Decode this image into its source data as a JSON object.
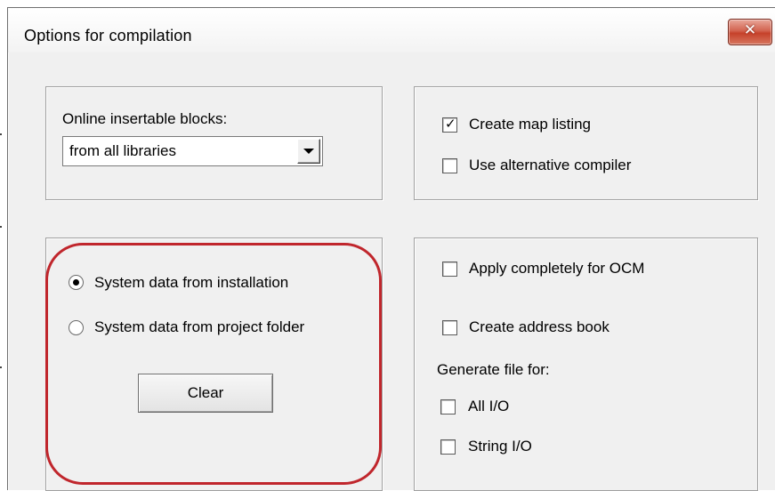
{
  "window": {
    "title": "Options for compilation",
    "close_glyph": "✕"
  },
  "blocks_group": {
    "label": "Online insertable blocks:",
    "select_value": "from all libraries"
  },
  "options_group": {
    "create_map_listing": {
      "label": "Create map listing",
      "checked": true
    },
    "use_alternative_compiler": {
      "label": "Use alternative compiler",
      "checked": false
    }
  },
  "system_group": {
    "radio_installation": {
      "label": "System data from installation",
      "selected": true
    },
    "radio_project": {
      "label": "System data from project folder",
      "selected": false
    },
    "clear_label": "Clear"
  },
  "ocm_group": {
    "apply_ocm": {
      "label": "Apply completely for OCM",
      "checked": false
    },
    "address_book": {
      "label": "Create address book",
      "checked": false
    },
    "generate_label": "Generate file for:",
    "all_io": {
      "label": "All I/O",
      "checked": false
    },
    "string_io": {
      "label": "String I/O",
      "checked": false
    }
  },
  "colors": {
    "highlight": "#c0262c",
    "close_button": "#c6412a"
  }
}
